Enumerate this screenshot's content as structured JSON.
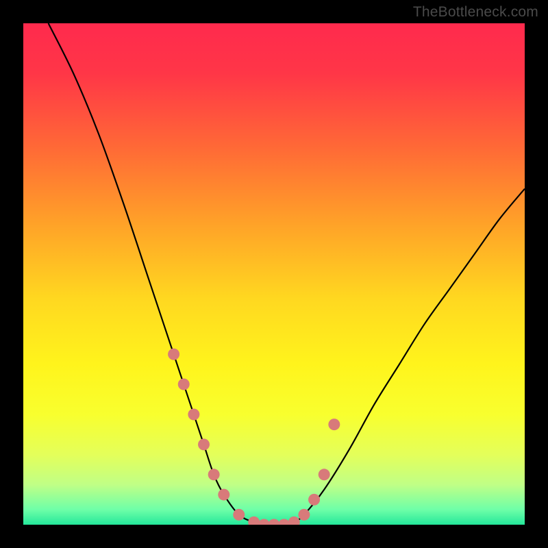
{
  "watermark": "TheBottleneck.com",
  "gradient_stops": [
    {
      "offset": 0.0,
      "color": "#ff2a4d"
    },
    {
      "offset": 0.1,
      "color": "#ff3647"
    },
    {
      "offset": 0.25,
      "color": "#ff6a36"
    },
    {
      "offset": 0.4,
      "color": "#ffa228"
    },
    {
      "offset": 0.55,
      "color": "#ffd820"
    },
    {
      "offset": 0.68,
      "color": "#fff41c"
    },
    {
      "offset": 0.78,
      "color": "#f8ff2e"
    },
    {
      "offset": 0.86,
      "color": "#e4ff5a"
    },
    {
      "offset": 0.92,
      "color": "#c0ff86"
    },
    {
      "offset": 0.97,
      "color": "#6effa8"
    },
    {
      "offset": 1.0,
      "color": "#24e79a"
    }
  ],
  "chart_data": {
    "type": "line",
    "title": "",
    "xlabel": "",
    "ylabel": "",
    "xlim": [
      0,
      100
    ],
    "ylim": [
      0,
      100
    ],
    "grid": false,
    "series": [
      {
        "name": "bottleneck-curve",
        "x": [
          5,
          10,
          15,
          20,
          25,
          28,
          30,
          32,
          34,
          36,
          38,
          40,
          43,
          46,
          48,
          50,
          52,
          54,
          56,
          60,
          65,
          70,
          75,
          80,
          85,
          90,
          95,
          100
        ],
        "y": [
          100,
          90,
          78,
          64,
          49,
          40,
          34,
          28,
          22,
          16,
          10,
          6,
          2,
          0.5,
          0,
          0,
          0,
          0.5,
          2,
          7,
          15,
          24,
          32,
          40,
          47,
          54,
          61,
          67
        ]
      }
    ],
    "markers": {
      "name": "highlight-points",
      "color": "#d87a7a",
      "x": [
        30,
        32,
        34,
        36,
        38,
        40,
        43,
        46,
        48,
        50,
        52,
        54,
        56,
        58,
        60,
        62
      ],
      "y": [
        34,
        28,
        22,
        16,
        10,
        6,
        2,
        0.5,
        0,
        0,
        0,
        0.5,
        2,
        5,
        10,
        20
      ]
    }
  }
}
